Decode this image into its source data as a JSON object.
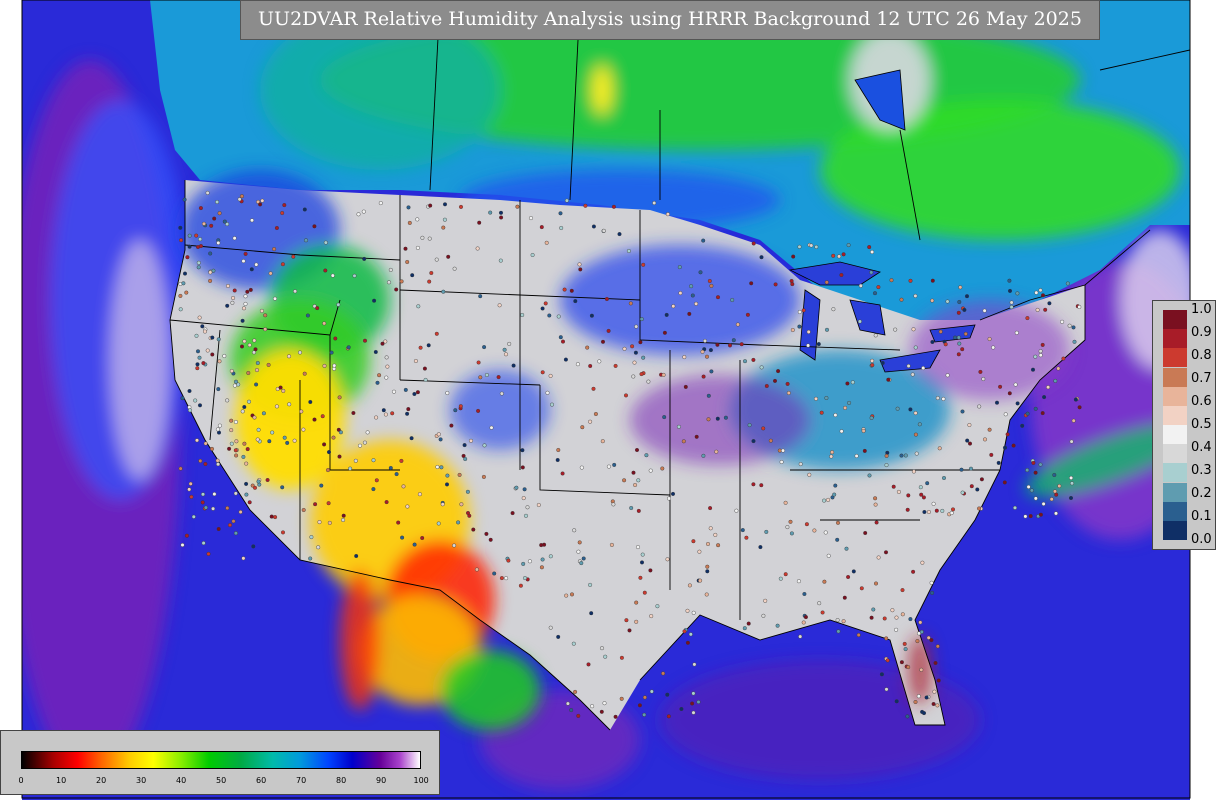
{
  "title": "UU2DVAR Relative Humidity Analysis using HRRR Background 12 UTC 26 May 2025",
  "colors": {
    "title_bg": "#8c8c8c",
    "ocean": "#2222cc",
    "gray_fill": "#d3d3d3"
  },
  "legend_right": {
    "labels": [
      "1.0",
      "0.9",
      "0.8",
      "0.7",
      "0.6",
      "0.5",
      "0.4",
      "0.3",
      "0.2",
      "0.1",
      "0.0"
    ],
    "colors": [
      "#7a1020",
      "#a81c28",
      "#cc3a2f",
      "#c97a55",
      "#e8b49a",
      "#f2d2c4",
      "#f2f2f2",
      "#d8d8d8",
      "#a8cfd0",
      "#5f9cb0",
      "#2a5f8f",
      "#0f2f66"
    ]
  },
  "legend_bottom": {
    "labels": [
      "0",
      "10",
      "20",
      "30",
      "40",
      "50",
      "60",
      "70",
      "80",
      "90",
      "100"
    ],
    "stops": [
      {
        "v": 0,
        "c": "#000000"
      },
      {
        "v": 8,
        "c": "#aa0000"
      },
      {
        "v": 14,
        "c": "#ff0000"
      },
      {
        "v": 20,
        "c": "#ff6600"
      },
      {
        "v": 27,
        "c": "#ffcc00"
      },
      {
        "v": 33,
        "c": "#ffff00"
      },
      {
        "v": 40,
        "c": "#88ee00"
      },
      {
        "v": 47,
        "c": "#00cc00"
      },
      {
        "v": 55,
        "c": "#00aa44"
      },
      {
        "v": 63,
        "c": "#00bbaa"
      },
      {
        "v": 70,
        "c": "#0099dd"
      },
      {
        "v": 77,
        "c": "#0044ff"
      },
      {
        "v": 83,
        "c": "#0000cc"
      },
      {
        "v": 90,
        "c": "#660099"
      },
      {
        "v": 95,
        "c": "#aa44cc"
      },
      {
        "v": 100,
        "c": "#ffffff"
      }
    ]
  }
}
